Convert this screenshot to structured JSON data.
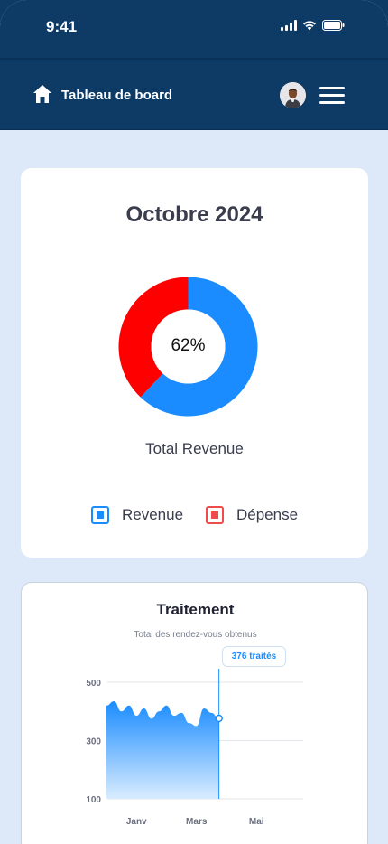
{
  "status_bar": {
    "time": "9:41"
  },
  "navbar": {
    "title": "Tableau de board"
  },
  "summary_card": {
    "title": "Octobre 2024",
    "percent_label": "62%",
    "caption": "Total Revenue",
    "legend": [
      {
        "label": "Revenue",
        "color": "#1a8cff"
      },
      {
        "label": "Dépense",
        "color": "#ff0000"
      }
    ]
  },
  "treatment_card": {
    "title": "Traitement",
    "subtitle": "Total des rendez-vous obtenus",
    "tooltip": "376 traités"
  },
  "chart_data": [
    {
      "type": "pie",
      "slices": [
        {
          "label": "Revenue",
          "value": 62,
          "color": "#1a8cff"
        },
        {
          "label": "Dépense",
          "value": 38,
          "color": "#ff0000"
        }
      ],
      "center_label": "62%"
    },
    {
      "type": "area",
      "title": "Traitement",
      "subtitle": "Total des rendez-vous obtenus",
      "y_ticks": [
        500,
        300,
        100
      ],
      "ylim": [
        100,
        500
      ],
      "x_ticks": [
        "Janv",
        "Mars",
        "Mai"
      ],
      "xlim": [
        0,
        6
      ],
      "x_tick_positions": [
        1,
        3,
        5
      ],
      "series": [
        {
          "x": [
            0,
            0.25,
            0.5,
            0.75,
            1.0,
            1.25,
            1.5,
            1.75,
            2.0,
            2.25,
            2.5,
            2.75,
            3.0,
            3.25,
            3.5,
            3.75
          ],
          "values": [
            420,
            435,
            400,
            420,
            385,
            410,
            375,
            400,
            420,
            385,
            395,
            360,
            350,
            410,
            395,
            376
          ]
        }
      ],
      "highlight": {
        "x": 3.75,
        "value": 376,
        "label": "376 traités"
      },
      "grid": true
    }
  ]
}
